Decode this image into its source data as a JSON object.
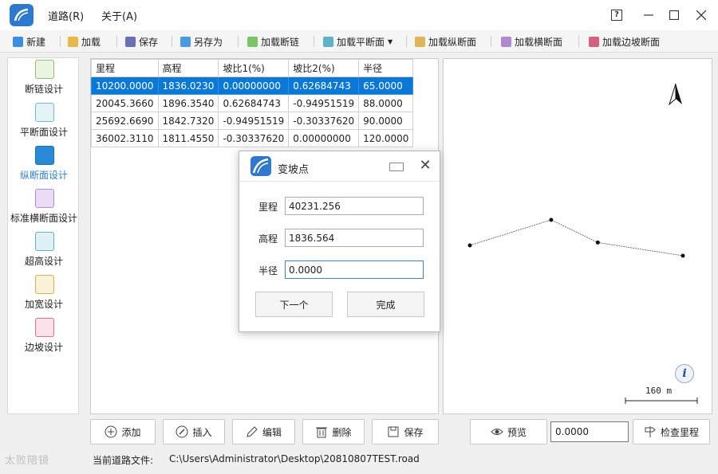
{
  "titlebar": {
    "menus": [
      "道路(R)",
      "关于(A)"
    ],
    "help_label": "?"
  },
  "toolbar": {
    "new": "新建",
    "load": "加载",
    "save": "保存",
    "save_as": "另存为",
    "load_chain": "加载断链",
    "load_plan": "加载平断面",
    "load_profile": "加载纵断面",
    "load_cross": "加载横断面",
    "load_slope": "加载边坡断面"
  },
  "sidebar": {
    "items": [
      {
        "label": "断链设计",
        "icon": "chain-break-icon"
      },
      {
        "label": "平断面设计",
        "icon": "plan-section-icon"
      },
      {
        "label": "纵断面设计",
        "icon": "profile-section-icon",
        "active": true
      },
      {
        "label": "标准横断面设计",
        "icon": "cross-section-icon"
      },
      {
        "label": "超高设计",
        "icon": "superelevation-icon"
      },
      {
        "label": "加宽设计",
        "icon": "widening-icon"
      },
      {
        "label": "边坡设计",
        "icon": "slope-icon"
      }
    ]
  },
  "table": {
    "columns": [
      "里程",
      "高程",
      "坡比1(%)",
      "坡比2(%)",
      "半径"
    ],
    "rows": [
      [
        "10200.0000",
        "1836.0230",
        "0.00000000",
        "0.62684743",
        "65.0000"
      ],
      [
        "20045.3660",
        "1896.3540",
        "0.62684743",
        "-0.94951519",
        "88.0000"
      ],
      [
        "25692.6690",
        "1842.7320",
        "-0.94951519",
        "-0.30337620",
        "90.0000"
      ],
      [
        "36002.3110",
        "1811.4550",
        "-0.30337620",
        "0.00000000",
        "120.0000"
      ]
    ],
    "selected_row": 0
  },
  "dialog": {
    "title": "变坡点",
    "fields": [
      {
        "label": "里程",
        "value": "40231.256"
      },
      {
        "label": "高程",
        "value": "1836.564"
      },
      {
        "label": "半径",
        "value": "0.0000"
      }
    ],
    "next_label": "下一个",
    "done_label": "完成"
  },
  "preview": {
    "scale_label": "160 m",
    "info_label": "i"
  },
  "actions": {
    "add": "添加",
    "insert": "插入",
    "edit": "编辑",
    "delete": "删除",
    "save": "保存",
    "preview": "预览",
    "check_chainage": "检查里程",
    "value_input": "0.0000"
  },
  "status": {
    "label": "当前道路文件:",
    "path": "C:\\Users\\Administrator\\Desktop\\20810807TEST.road",
    "watermark": "太败陪镜"
  },
  "colors": {
    "accent": "#0a78d7",
    "logo": "#2e78d0"
  }
}
